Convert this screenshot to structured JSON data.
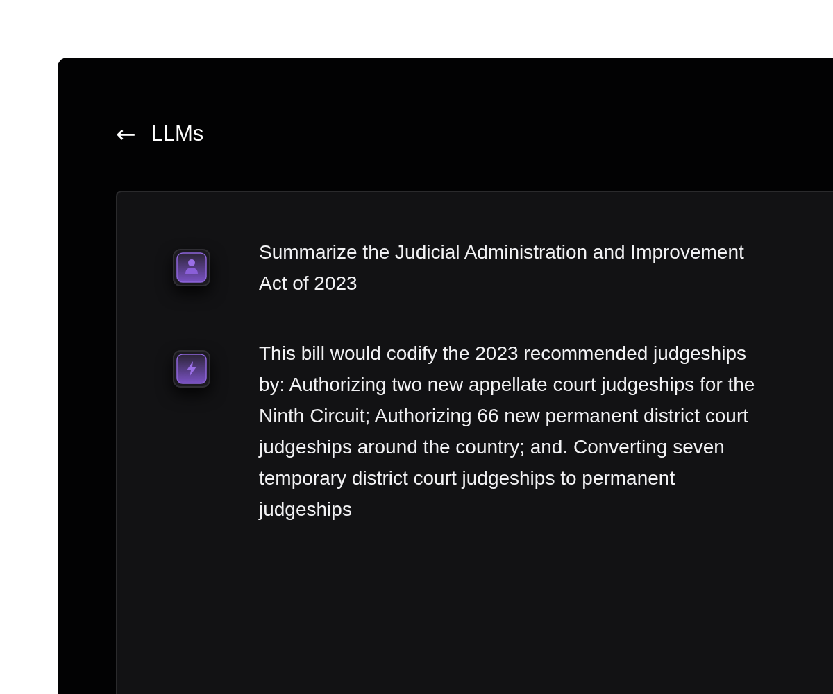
{
  "header": {
    "back": "←",
    "title": "LLMs"
  },
  "messages": [
    {
      "kind": "user",
      "text": "Summarize the Judicial Administration and Improvement Act of 2023"
    },
    {
      "kind": "assistant",
      "text": "This bill would codify the 2023 recommended judgeships by: Authorizing two new appellate court judgeships for the Ninth Circuit; Authorizing 66 new permanent district court judgeships around the country; and. Converting seven temporary district court judgeships to permanent judgeships"
    }
  ]
}
